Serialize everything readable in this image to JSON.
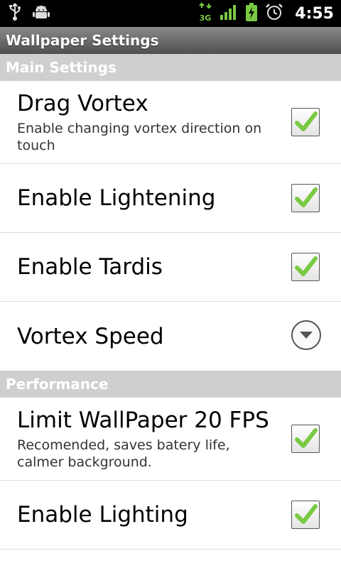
{
  "status_bar": {
    "time": "4:55",
    "network": "3G",
    "icons": [
      "usb-icon",
      "android-debug-icon",
      "3g-data-icon",
      "signal-icon",
      "battery-charging-icon",
      "alarm-icon"
    ]
  },
  "title": "Wallpaper Settings",
  "sections": {
    "main": {
      "header": "Main Settings",
      "items": [
        {
          "title": "Drag Vortex",
          "summary": "Enable changing vortex direction on touch",
          "checked": true
        },
        {
          "title": "Enable Lightening",
          "checked": true
        },
        {
          "title": "Enable Tardis",
          "checked": true
        },
        {
          "title": "Vortex Speed",
          "control": "dropdown"
        }
      ]
    },
    "performance": {
      "header": "Performance",
      "items": [
        {
          "title": "Limit WallPaper 20 FPS",
          "summary": "Recomended, saves batery life, calmer background.",
          "checked": true
        },
        {
          "title": "Enable Lighting",
          "checked": true
        }
      ]
    }
  },
  "colors": {
    "check": "#7ac943",
    "section_bg": "#cfcfcf",
    "status_icon_green": "#7ac943"
  }
}
